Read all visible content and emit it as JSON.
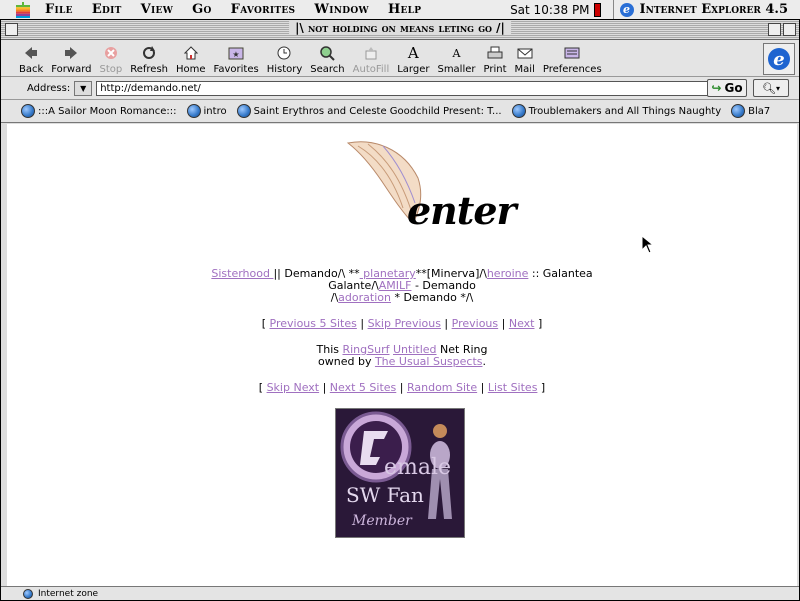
{
  "menubar": {
    "items": [
      "File",
      "Edit",
      "View",
      "Go",
      "Favorites",
      "Window",
      "Help"
    ],
    "clock": "Sat 10:38 PM",
    "app_name": "Internet Explorer 4.5"
  },
  "window": {
    "title": "|\\ not holding on means leting go /|"
  },
  "toolbar": {
    "back": "Back",
    "forward": "Forward",
    "stop": "Stop",
    "refresh": "Refresh",
    "home": "Home",
    "favorites": "Favorites",
    "history": "History",
    "search": "Search",
    "autofill": "AutoFill",
    "larger": "Larger",
    "smaller": "Smaller",
    "print": "Print",
    "mail": "Mail",
    "preferences": "Preferences"
  },
  "address": {
    "label": "Address:",
    "url": "http://demando.net/",
    "go_label": "Go"
  },
  "favorites_bar": [
    ":::A Sailor Moon Romance:::",
    "intro",
    "Saint Erythros and Celeste Goodchild Present: T...",
    "Troublemakers and All Things Naughty",
    "Bla7"
  ],
  "page": {
    "enter_text": "enter",
    "line1": {
      "sisterhood": "Sisterhood ",
      "t1": "|| Demando/\\ **",
      "planetary": " planetary",
      "t2": "**[Minerva]/\\",
      "heroine": "heroine",
      "t3": " :: Galantea"
    },
    "line2": {
      "t1": "Galante/\\",
      "amilf": "AMILF",
      "t2": " - Demando"
    },
    "line3": {
      "t1": "/\\",
      "adoration": "adoration",
      "t2": " * Demando */\\"
    },
    "nav1": {
      "open": "[ ",
      "prev5": "Previous 5 Sites",
      "sep": " | ",
      "skip_prev": "Skip Previous",
      "previous": "Previous",
      "next": "Next",
      "close": " ]"
    },
    "ring": {
      "t1": "This ",
      "ringsurf": "RingSurf",
      "untitled": "Untitled",
      "t2": " Net Ring",
      "t3": "owned by ",
      "owner": "The Usual Suspects",
      "t4": "."
    },
    "nav2": {
      "open": "[ ",
      "skip_next": "Skip Next",
      "next5": "Next 5 Sites",
      "random": "Random Site",
      "list": "List Sites",
      "close": " ]"
    },
    "banner": {
      "line1": "emale",
      "line2": "SW Fan",
      "line3": "Member"
    }
  },
  "status": {
    "zone": "Internet zone"
  },
  "colors": {
    "link": "#a070c0",
    "chrome": "#e4e4e4"
  }
}
